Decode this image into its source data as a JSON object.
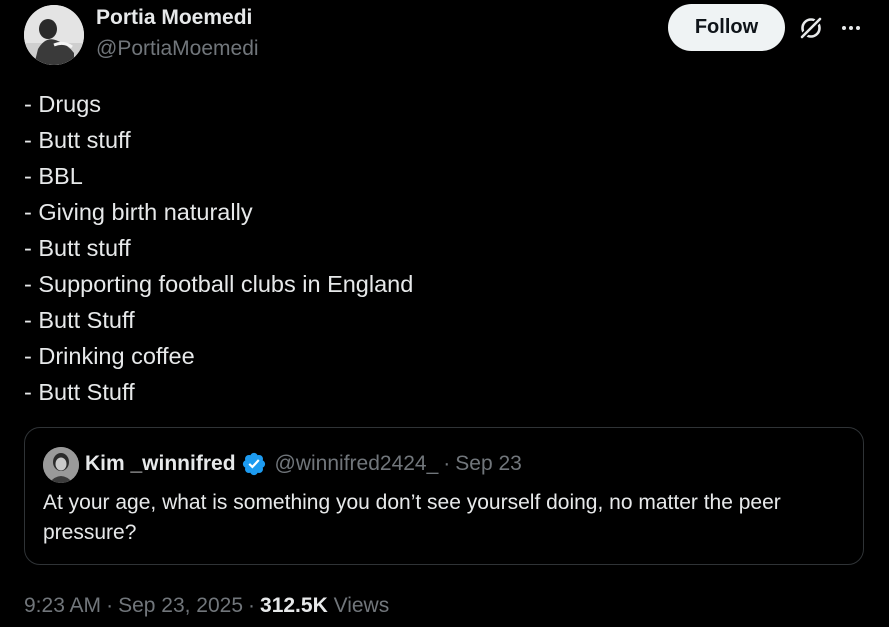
{
  "author": {
    "name": "Portia Moemedi",
    "handle": "@PortiaMoemedi",
    "avatar_icon": "profile-photo"
  },
  "actions": {
    "follow_label": "Follow",
    "grok_icon": "grok-icon",
    "more_icon": "more-horizontal-icon"
  },
  "tweet": {
    "lines": [
      "- Drugs",
      "- Butt stuff",
      "- BBL",
      "- Giving birth naturally",
      "- Butt stuff",
      "- Supporting football clubs in England",
      "- Butt Stuff",
      "- Drinking coffee",
      "- Butt Stuff"
    ]
  },
  "quote": {
    "name": "Kim _winnifred",
    "handle": "@winnifred2424_",
    "separator": "·",
    "date": "Sep 23",
    "text": "At your age, what is something you don’t see yourself doing, no matter the peer pressure?",
    "verified_color": "#1d9bf0"
  },
  "meta": {
    "time": "9:23 AM",
    "separator": "·",
    "date": "Sep 23, 2025",
    "views_count": "312.5K",
    "views_label": "Views"
  },
  "colors": {
    "background": "#000000",
    "primary_text": "#e7e9ea",
    "secondary_text": "#71767b",
    "border": "#2f3336",
    "follow_bg": "#eff3f4"
  }
}
